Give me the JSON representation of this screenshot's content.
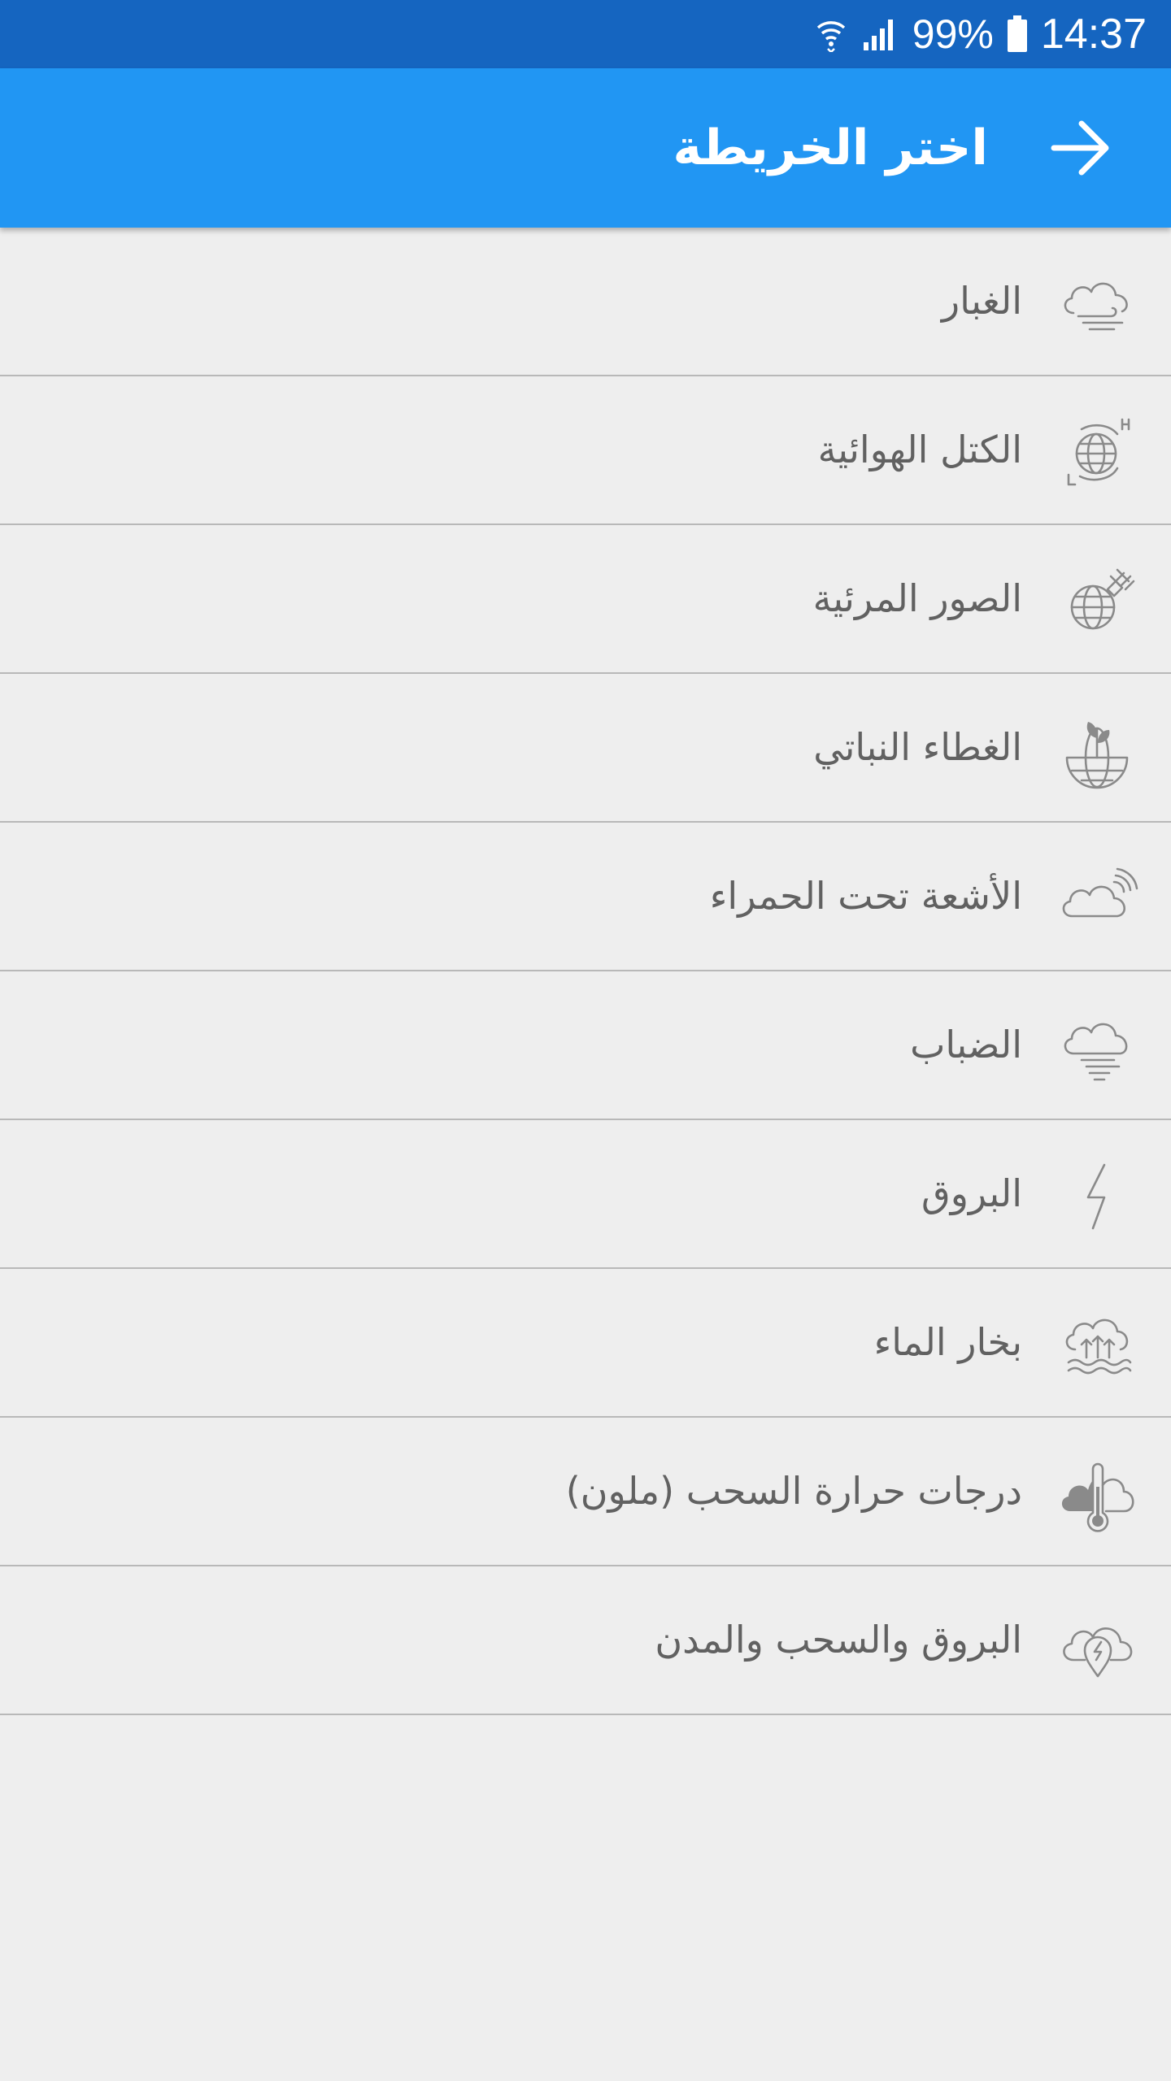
{
  "status_bar": {
    "battery_percent": "99%",
    "time": "14:37",
    "icons": [
      "wifi-icon",
      "signal-icon",
      "battery-icon"
    ]
  },
  "app_bar": {
    "title": "اختر الخريطة",
    "back_icon": "arrow-right-icon",
    "color": "#2196f3"
  },
  "map_list": {
    "items": [
      {
        "label": "الغبار",
        "icon": "cloud-wind-icon"
      },
      {
        "label": "الكتل الهوائية",
        "icon": "globe-air-mass-icon"
      },
      {
        "label": "الصور المرئية",
        "icon": "globe-satellite-icon"
      },
      {
        "label": "الغطاء النباتي",
        "icon": "globe-plant-icon"
      },
      {
        "label": "الأشعة تحت الحمراء",
        "icon": "cloud-infrared-icon"
      },
      {
        "label": "الضباب",
        "icon": "cloud-fog-icon"
      },
      {
        "label": "البروق",
        "icon": "lightning-icon"
      },
      {
        "label": "بخار الماء",
        "icon": "cloud-water-vapor-icon"
      },
      {
        "label": "درجات حرارة السحب (ملون)",
        "icon": "cloud-thermometer-icon"
      },
      {
        "label": "البروق والسحب والمدن",
        "icon": "cloud-lightning-pin-icon"
      }
    ]
  },
  "colors": {
    "status_bar": "#1565c0",
    "background": "#eeeeee",
    "item_text": "#616161",
    "divider": "#b8b8b8"
  }
}
